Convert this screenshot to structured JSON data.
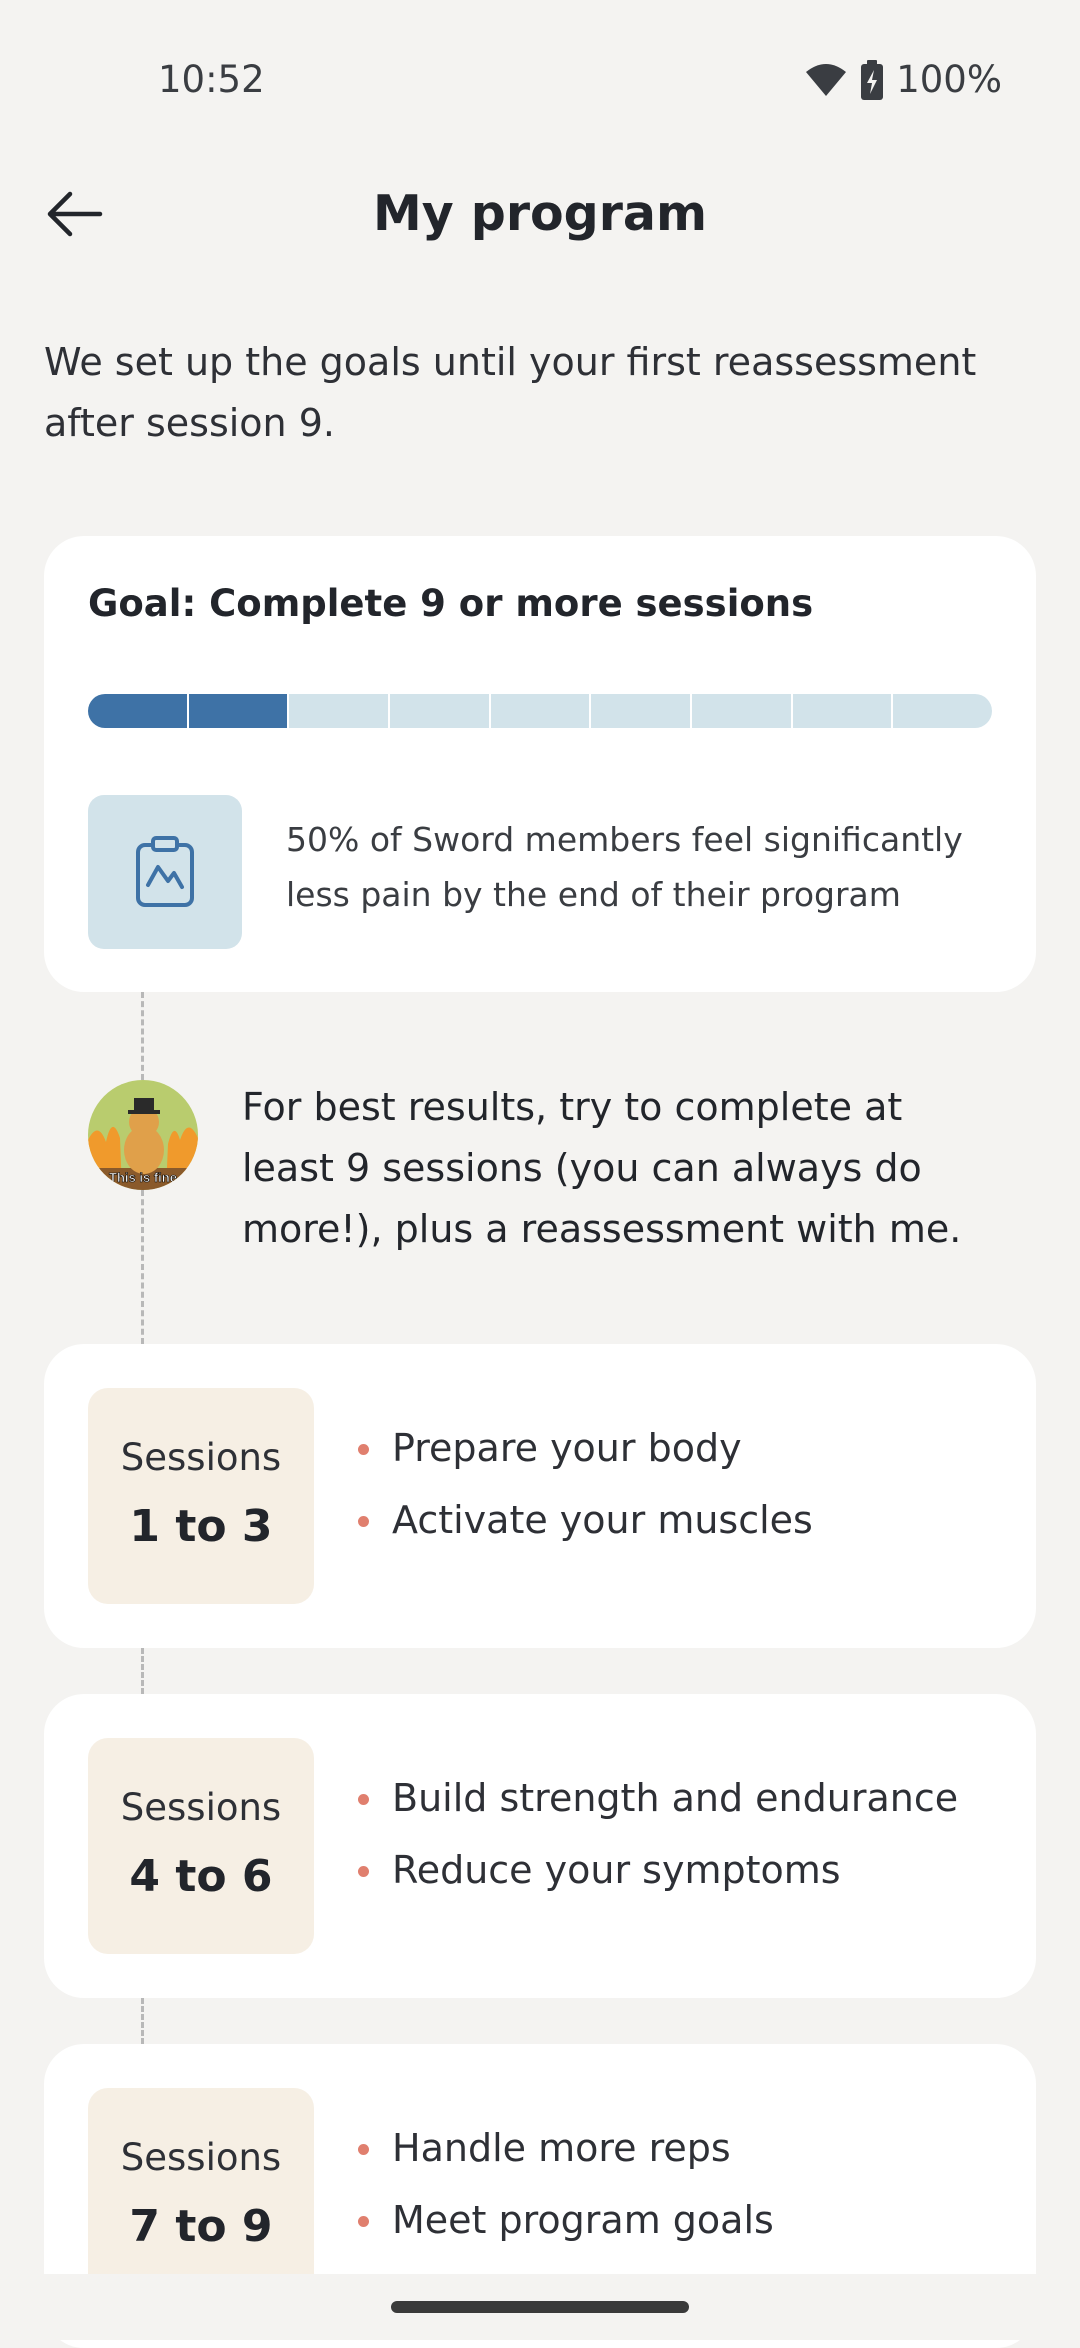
{
  "status_bar": {
    "time": "10:52",
    "battery": "100%"
  },
  "header": {
    "title": "My program",
    "back_icon": "arrow-left-icon"
  },
  "intro_text": "We set up the goals until your first reassessment after session 9.",
  "goal_card": {
    "title": "Goal: Complete 9 or more sessions",
    "progress": {
      "completed": 2,
      "total": 9
    },
    "icon": "clipboard-chart-icon",
    "stat_text": "50% of Sword members feel significantly less pain by the end of their program"
  },
  "coach": {
    "avatar_caption": "This is fine",
    "message": "For best results, try to complete at least 9 sessions (you can always do more!), plus a reassessment with me."
  },
  "phases": [
    {
      "label": "Sessions",
      "range": "1 to 3",
      "goals": [
        "Prepare your body",
        "Activate your muscles"
      ]
    },
    {
      "label": "Sessions",
      "range": "4 to 6",
      "goals": [
        "Build strength and endurance",
        "Reduce your symptoms"
      ]
    },
    {
      "label": "Sessions",
      "range": "7 to 9",
      "goals": [
        "Handle more reps",
        "Meet program goals"
      ]
    }
  ],
  "colors": {
    "background": "#F4F3F1",
    "progress_done": "#3E72A6",
    "progress_remaining": "#D2E3EA",
    "bullet": "#E07F6E",
    "session_tag": "#F6EFE4"
  }
}
